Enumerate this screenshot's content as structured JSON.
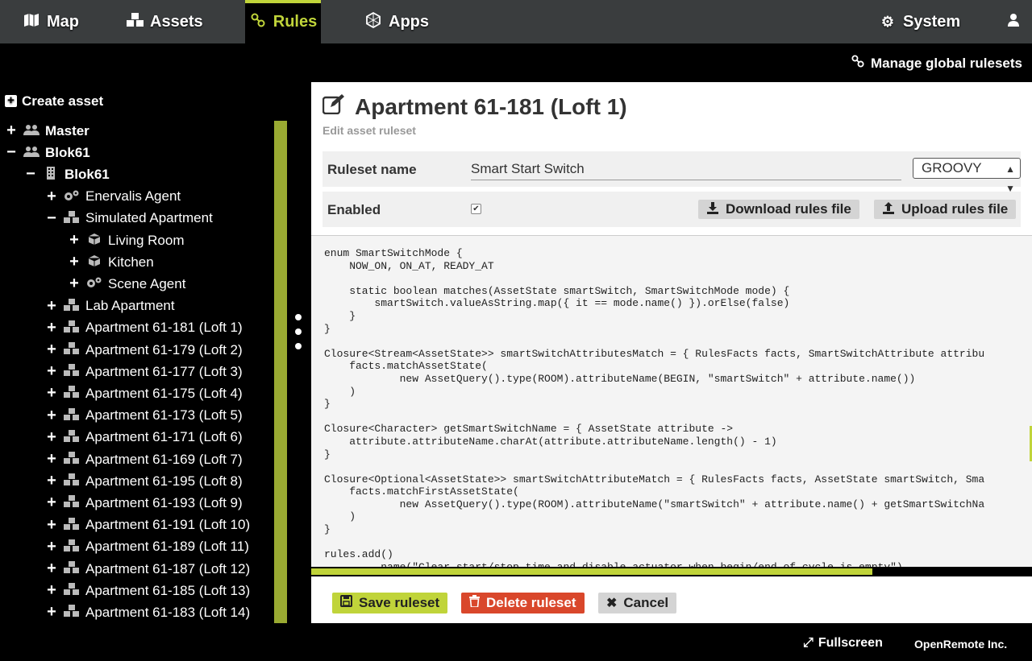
{
  "nav": {
    "map": "Map",
    "assets": "Assets",
    "rules": "Rules",
    "apps": "Apps",
    "system": "System"
  },
  "subbar": {
    "manage_link": "Manage global rulesets"
  },
  "sidebar": {
    "create_asset": "Create asset",
    "items": [
      {
        "label": "Master",
        "toggle": "+",
        "icon": "users-icon"
      },
      {
        "label": "Blok61",
        "toggle": "−",
        "icon": "users-icon"
      },
      {
        "label": "Blok61",
        "toggle": "−",
        "icon": "building-icon"
      },
      {
        "label": "Enervalis Agent",
        "toggle": "+",
        "icon": "cogs-icon"
      },
      {
        "label": "Simulated Apartment",
        "toggle": "−",
        "icon": "cubes-icon"
      },
      {
        "label": "Living Room",
        "toggle": "+",
        "icon": "cube-icon"
      },
      {
        "label": "Kitchen",
        "toggle": "+",
        "icon": "cube-icon"
      },
      {
        "label": "Scene Agent",
        "toggle": "+",
        "icon": "cogs-icon"
      },
      {
        "label": "Lab Apartment",
        "toggle": "+",
        "icon": "cubes-icon"
      },
      {
        "label": "Apartment 61-181 (Loft 1)",
        "toggle": "+",
        "icon": "cubes-icon"
      },
      {
        "label": "Apartment 61-179 (Loft 2)",
        "toggle": "+",
        "icon": "cubes-icon"
      },
      {
        "label": "Apartment 61-177 (Loft 3)",
        "toggle": "+",
        "icon": "cubes-icon"
      },
      {
        "label": "Apartment 61-175 (Loft 4)",
        "toggle": "+",
        "icon": "cubes-icon"
      },
      {
        "label": "Apartment 61-173 (Loft 5)",
        "toggle": "+",
        "icon": "cubes-icon"
      },
      {
        "label": "Apartment 61-171 (Loft 6)",
        "toggle": "+",
        "icon": "cubes-icon"
      },
      {
        "label": "Apartment 61-169 (Loft 7)",
        "toggle": "+",
        "icon": "cubes-icon"
      },
      {
        "label": "Apartment 61-195 (Loft 8)",
        "toggle": "+",
        "icon": "cubes-icon"
      },
      {
        "label": "Apartment 61-193 (Loft 9)",
        "toggle": "+",
        "icon": "cubes-icon"
      },
      {
        "label": "Apartment 61-191 (Loft 10)",
        "toggle": "+",
        "icon": "cubes-icon"
      },
      {
        "label": "Apartment 61-189 (Loft 11)",
        "toggle": "+",
        "icon": "cubes-icon"
      },
      {
        "label": "Apartment 61-187 (Loft 12)",
        "toggle": "+",
        "icon": "cubes-icon"
      },
      {
        "label": "Apartment 61-185 (Loft 13)",
        "toggle": "+",
        "icon": "cubes-icon"
      },
      {
        "label": "Apartment 61-183 (Loft 14)",
        "toggle": "+",
        "icon": "cubes-icon"
      }
    ]
  },
  "main": {
    "title": "Apartment 61-181 (Loft 1)",
    "subtitle": "Edit asset ruleset",
    "ruleset_name_label": "Ruleset name",
    "ruleset_name_value": "Smart Start Switch",
    "language": "GROOVY",
    "enabled_label": "Enabled",
    "enabled": true,
    "download_label": "Download rules file",
    "upload_label": "Upload rules file",
    "code": "enum SmartSwitchMode {\n    NOW_ON, ON_AT, READY_AT\n\n    static boolean matches(AssetState smartSwitch, SmartSwitchMode mode) {\n        smartSwitch.valueAsString.map({ it == mode.name() }).orElse(false)\n    }\n}\n\nClosure<Stream<AssetState>> smartSwitchAttributesMatch = { RulesFacts facts, SmartSwitchAttribute attribu\n    facts.matchAssetState(\n            new AssetQuery().type(ROOM).attributeName(BEGIN, \"smartSwitch\" + attribute.name())\n    )\n}\n\nClosure<Character> getSmartSwitchName = { AssetState attribute ->\n    attribute.attributeName.charAt(attribute.attributeName.length() - 1)\n}\n\nClosure<Optional<AssetState>> smartSwitchAttributeMatch = { RulesFacts facts, AssetState smartSwitch, Sma\n    facts.matchFirstAssetState(\n            new AssetQuery().type(ROOM).attributeName(\"smartSwitch\" + attribute.name() + getSmartSwitchNa\n    )\n}\n\nrules.add()\n        .name(\"Clear start/stop time and disable actuator when begin/end of cycle is empty\")",
    "save_label": "Save ruleset",
    "delete_label": "Delete ruleset",
    "cancel_label": "Cancel"
  },
  "footer": {
    "fullscreen_label": "Fullscreen",
    "brand": "OpenRemote Inc."
  },
  "colors": {
    "accent": "#c0d43a",
    "danger": "#d9472b",
    "topbar": "#3a3d3e"
  }
}
